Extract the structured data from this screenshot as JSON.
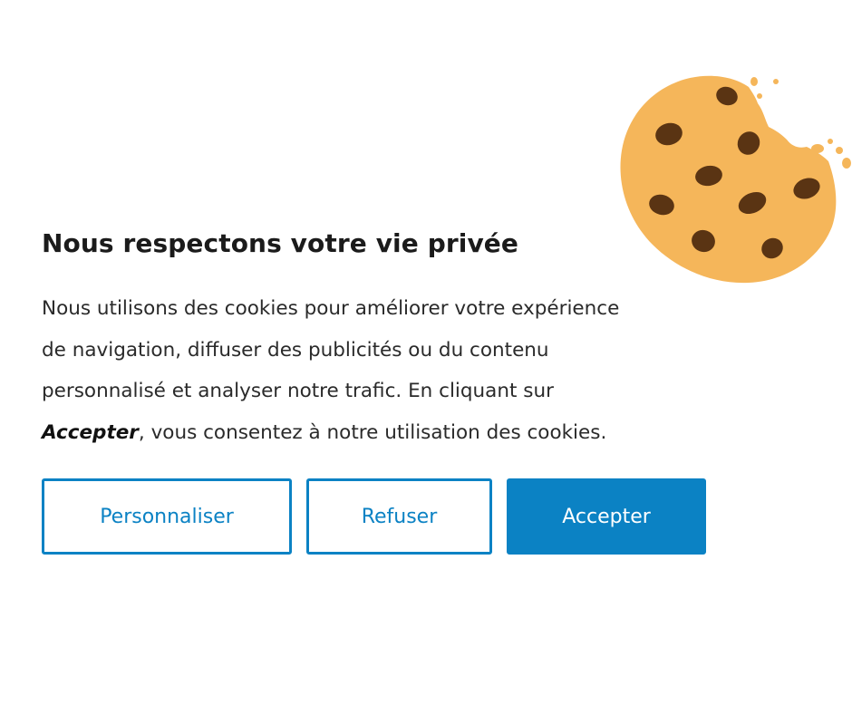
{
  "dialog": {
    "title": "Nous respectons votre vie privée",
    "body": {
      "line1": "Nous utilisons des cookies pour améliorer votre expérience",
      "line2": "de navigation, diffuser des publicités ou du contenu",
      "line3": "personnalisé et analyser notre trafic. En cliquant sur",
      "line4_emphasis": "Accepter",
      "line4_rest": ", vous consentez à notre utilisation des cookies."
    },
    "buttons": {
      "customize": "Personnaliser",
      "refuse": "Refuser",
      "accept": "Accepter"
    }
  },
  "illustration": {
    "icon": "cookie-icon"
  },
  "colors": {
    "accent": "#0b82c4",
    "cookie": "#f5b65a",
    "chocolate_chip": "#5a3413",
    "text": "#2a2a2a"
  }
}
